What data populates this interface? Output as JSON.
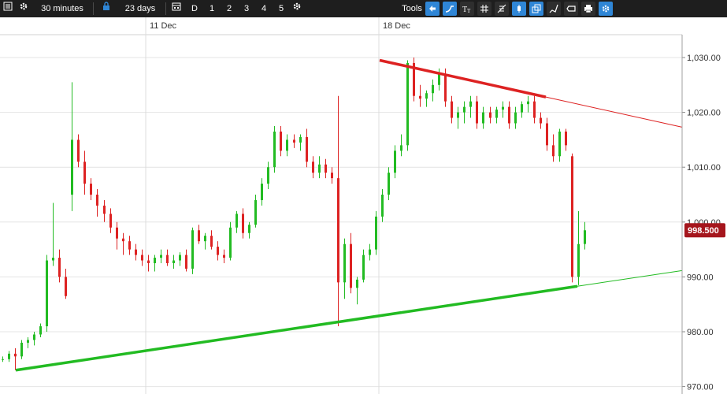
{
  "toolbar": {
    "interval": "30 minutes",
    "range": "23 days",
    "period_buttons": [
      "D",
      "1",
      "2",
      "3",
      "4",
      "5"
    ],
    "tools_label": "Tools",
    "tools_icons": [
      "arrow-left-icon",
      "curve-icon",
      "text-tool-icon",
      "crosshair-grid-icon",
      "fib-tool-icon",
      "candle-type-icon",
      "layers-icon",
      "brush-icon",
      "eraser-icon",
      "print-icon",
      "settings-icon"
    ]
  },
  "chart_data": {
    "type": "candlestick",
    "title": "",
    "xlabel": "",
    "ylabel": "",
    "ylim": [
      970,
      1032
    ],
    "y_ticks": [
      "1,030.00",
      "1,020.00",
      "1,010.00",
      "1,000.00",
      "990.00",
      "980.00",
      "970.00"
    ],
    "y_tick_values": [
      1030,
      1020,
      1010,
      1000,
      990,
      980,
      970
    ],
    "x_tick_labels": [
      "11 Dec",
      "18 Dec"
    ],
    "last_price_label": "998.500",
    "last_price": 998.5,
    "grid": true,
    "up_color": "#22bb22",
    "down_color": "#dd2222",
    "candles": [
      [
        975,
        975.5,
        974.5,
        975
      ],
      [
        975,
        976.5,
        974.5,
        976
      ],
      [
        976,
        977,
        973,
        975.5
      ],
      [
        975.5,
        978.5,
        975,
        978
      ],
      [
        978,
        979,
        977,
        978.5
      ],
      [
        978.5,
        980,
        977.5,
        979.5
      ],
      [
        979.5,
        981.5,
        979,
        981
      ],
      [
        981,
        994,
        980,
        993
      ],
      [
        993,
        1003.5,
        992,
        993.5
      ],
      [
        993.5,
        995,
        989,
        990
      ],
      [
        990,
        991.5,
        986,
        986.5
      ],
      [
        1005,
        1025.5,
        1002,
        1015
      ],
      [
        1015,
        1016,
        1010,
        1011
      ],
      [
        1011,
        1013,
        1005,
        1007
      ],
      [
        1007,
        1008,
        1004,
        1005
      ],
      [
        1005,
        1006,
        1001,
        1003
      ],
      [
        1003,
        1004,
        1000,
        1001.5
      ],
      [
        1001.5,
        1002.5,
        998,
        999
      ],
      [
        999,
        1000,
        995,
        997
      ],
      [
        997,
        998,
        994,
        996.5
      ],
      [
        996.5,
        997.5,
        994,
        995
      ],
      [
        995,
        996,
        993,
        994
      ],
      [
        994,
        995,
        992,
        993
      ],
      [
        993,
        994,
        991,
        992.5
      ],
      [
        992.5,
        994,
        991,
        993.5
      ],
      [
        993.5,
        995,
        992.5,
        994
      ],
      [
        994,
        995,
        992,
        992.5
      ],
      [
        992.5,
        994,
        991.5,
        993
      ],
      [
        993,
        994.5,
        992,
        994
      ],
      [
        994,
        995,
        991,
        991.5
      ],
      [
        991.5,
        999,
        990.5,
        998.5
      ],
      [
        998.5,
        999.5,
        996,
        996.5
      ],
      [
        996.5,
        998,
        995,
        997.5
      ],
      [
        997.5,
        998.5,
        995,
        995.5
      ],
      [
        995.5,
        996.5,
        993,
        994
      ],
      [
        994,
        995,
        992.5,
        993.5
      ],
      [
        993.5,
        1000,
        993,
        999
      ],
      [
        999,
        1002,
        998,
        1001.5
      ],
      [
        1001.5,
        1002.5,
        997,
        998
      ],
      [
        998,
        1000,
        997,
        999.5
      ],
      [
        999.5,
        1005,
        999,
        1004
      ],
      [
        1004,
        1008,
        1003,
        1007
      ],
      [
        1007,
        1011,
        1006,
        1010
      ],
      [
        1010,
        1017.5,
        1009,
        1016.5
      ],
      [
        1016.5,
        1017.5,
        1012,
        1013
      ],
      [
        1013,
        1016,
        1012,
        1015
      ],
      [
        1015,
        1016,
        1013.5,
        1014.5
      ],
      [
        1014.5,
        1016,
        1013,
        1015.5
      ],
      [
        1015.5,
        1017,
        1010,
        1011
      ],
      [
        1011,
        1012,
        1008,
        1009
      ],
      [
        1009,
        1012,
        1008,
        1010.5
      ],
      [
        1010.5,
        1011.5,
        1008,
        1009
      ],
      [
        1009,
        1010,
        1007,
        1008
      ],
      [
        1008,
        1023,
        981,
        989
      ],
      [
        989,
        997,
        986,
        996
      ],
      [
        996,
        998,
        987,
        988
      ],
      [
        988,
        990,
        985,
        989.5
      ],
      [
        989.5,
        995,
        989,
        994
      ],
      [
        994,
        996,
        993,
        995
      ],
      [
        995,
        1002,
        994,
        1001
      ],
      [
        1001,
        1006,
        1000,
        1005
      ],
      [
        1005,
        1010,
        1004,
        1009
      ],
      [
        1009,
        1014,
        1008,
        1013
      ],
      [
        1013,
        1016,
        1012,
        1014
      ],
      [
        1014,
        1029.5,
        1013,
        1029
      ],
      [
        1029,
        1030,
        1022,
        1023
      ],
      [
        1023,
        1025,
        1021,
        1022.5
      ],
      [
        1022.5,
        1024,
        1021,
        1023.5
      ],
      [
        1023.5,
        1026,
        1022,
        1025
      ],
      [
        1025,
        1028,
        1024,
        1027
      ],
      [
        1027,
        1028,
        1021,
        1022
      ],
      [
        1022,
        1023,
        1018,
        1019
      ],
      [
        1019,
        1021,
        1017,
        1020
      ],
      [
        1020,
        1022,
        1018,
        1021
      ],
      [
        1021,
        1023,
        1019,
        1022
      ],
      [
        1022,
        1023,
        1017,
        1018
      ],
      [
        1018,
        1021,
        1017,
        1020
      ],
      [
        1020,
        1021,
        1018,
        1019
      ],
      [
        1019,
        1021,
        1018,
        1020.5
      ],
      [
        1020.5,
        1022,
        1019,
        1021
      ],
      [
        1021,
        1022,
        1017,
        1018
      ],
      [
        1018,
        1021,
        1017,
        1020
      ],
      [
        1020,
        1022,
        1019,
        1021.5
      ],
      [
        1021.5,
        1023,
        1020,
        1022
      ],
      [
        1022,
        1023,
        1018,
        1019
      ],
      [
        1019,
        1020,
        1017,
        1018
      ],
      [
        1018,
        1019,
        1013,
        1014
      ],
      [
        1014,
        1016,
        1011,
        1012
      ],
      [
        1012,
        1017,
        1011,
        1016.5
      ],
      [
        1016.5,
        1017,
        1013,
        1014
      ],
      [
        1012,
        1012.5,
        989,
        990
      ],
      [
        990,
        1002,
        988.5,
        996
      ],
      [
        996,
        1000,
        995,
        998.5
      ]
    ],
    "trendlines": [
      {
        "name": "resistance",
        "color": "#dd2222",
        "from": [
          482,
          1029.5
        ],
        "to": [
          693,
          1022.8
        ],
        "extend_to_edge": true
      },
      {
        "name": "support",
        "color": "#22bb22",
        "from": [
          20,
          973
        ],
        "to": [
          733,
          988.3
        ],
        "extend_to_edge": true
      }
    ]
  }
}
